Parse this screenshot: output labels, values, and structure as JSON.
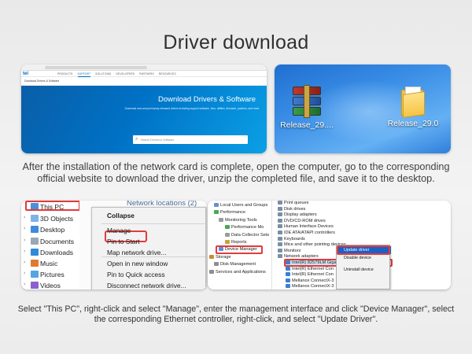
{
  "page": {
    "title": "Driver download",
    "description_1": "After the installation of the network card is complete, open the computer, go to the corresponding official website to download the driver, unzip the completed file, and save it to the desktop.",
    "description_2": "Select \"This PC\", right-click and select \"Manage\", enter the management interface and click \"Device Manager\", select the corresponding Ethernet controller, right-click, and select \"Update Driver\"."
  },
  "browser": {
    "logo": "tel",
    "nav": [
      "PRODUCTS",
      "SUPPORT",
      "SOLUTIONS",
      "DEVELOPERS",
      "PARTNERS",
      "RESOURCES"
    ],
    "active_nav": "SUPPORT",
    "subheader": "Download Drivers & Software",
    "hero_title": "Download Drivers & Software",
    "hero_subtitle": "Download new and previously released drivers including support software, bios, utilities, firmware, patches, and more",
    "search_placeholder": "Search Drivers & Software",
    "accent": "#0071c5"
  },
  "desktop": {
    "items": [
      {
        "label": "Release_29....",
        "icon": "winrar-archive-icon"
      },
      {
        "label": "Release_29.0",
        "icon": "folder-icon"
      }
    ]
  },
  "explorer": {
    "tree": [
      {
        "label": "This PC",
        "icon": "computer-icon"
      },
      {
        "label": "3D Objects",
        "icon": "cube-icon"
      },
      {
        "label": "Desktop",
        "icon": "desktop-icon"
      },
      {
        "label": "Documents",
        "icon": "documents-icon"
      },
      {
        "label": "Downloads",
        "icon": "downloads-icon"
      },
      {
        "label": "Music",
        "icon": "music-icon"
      },
      {
        "label": "Pictures",
        "icon": "pictures-icon"
      },
      {
        "label": "Videos",
        "icon": "videos-icon"
      }
    ],
    "network_locations": "Network locations (2)",
    "context_menu": [
      "Collapse",
      "Manage",
      "Pin to Start",
      "Map network drive...",
      "Open in new window",
      "Pin to Quick access",
      "Disconnect network drive..."
    ]
  },
  "device_manager": {
    "left_tree": [
      "Local Users and Groups",
      "Performance",
      "Monitoring Tools",
      "Performance Mo",
      "Data Collector Sets",
      "Reports",
      "Device Manager",
      "Storage",
      "Disk Management",
      "Services and Applications"
    ],
    "right_tree": [
      "Print queues",
      "Disk drives",
      "Display adapters",
      "DVD/CD-ROM drives",
      "Human Interface Devices",
      "IDE ATA/ATAPI controllers",
      "Keyboards",
      "Mice and other pointing devices",
      "Monitors",
      "Network adapters",
      "Intel(R) 82579LM Gigabit Network Connection",
      "Intel(R) Ethernet Con",
      "Intel(R) Ethernet Con",
      "Mellanox ConnectX-3",
      "Mellanox ConnectX-3"
    ],
    "context_menu": [
      "Update driver",
      "Disable device",
      "Uninstall device"
    ]
  }
}
